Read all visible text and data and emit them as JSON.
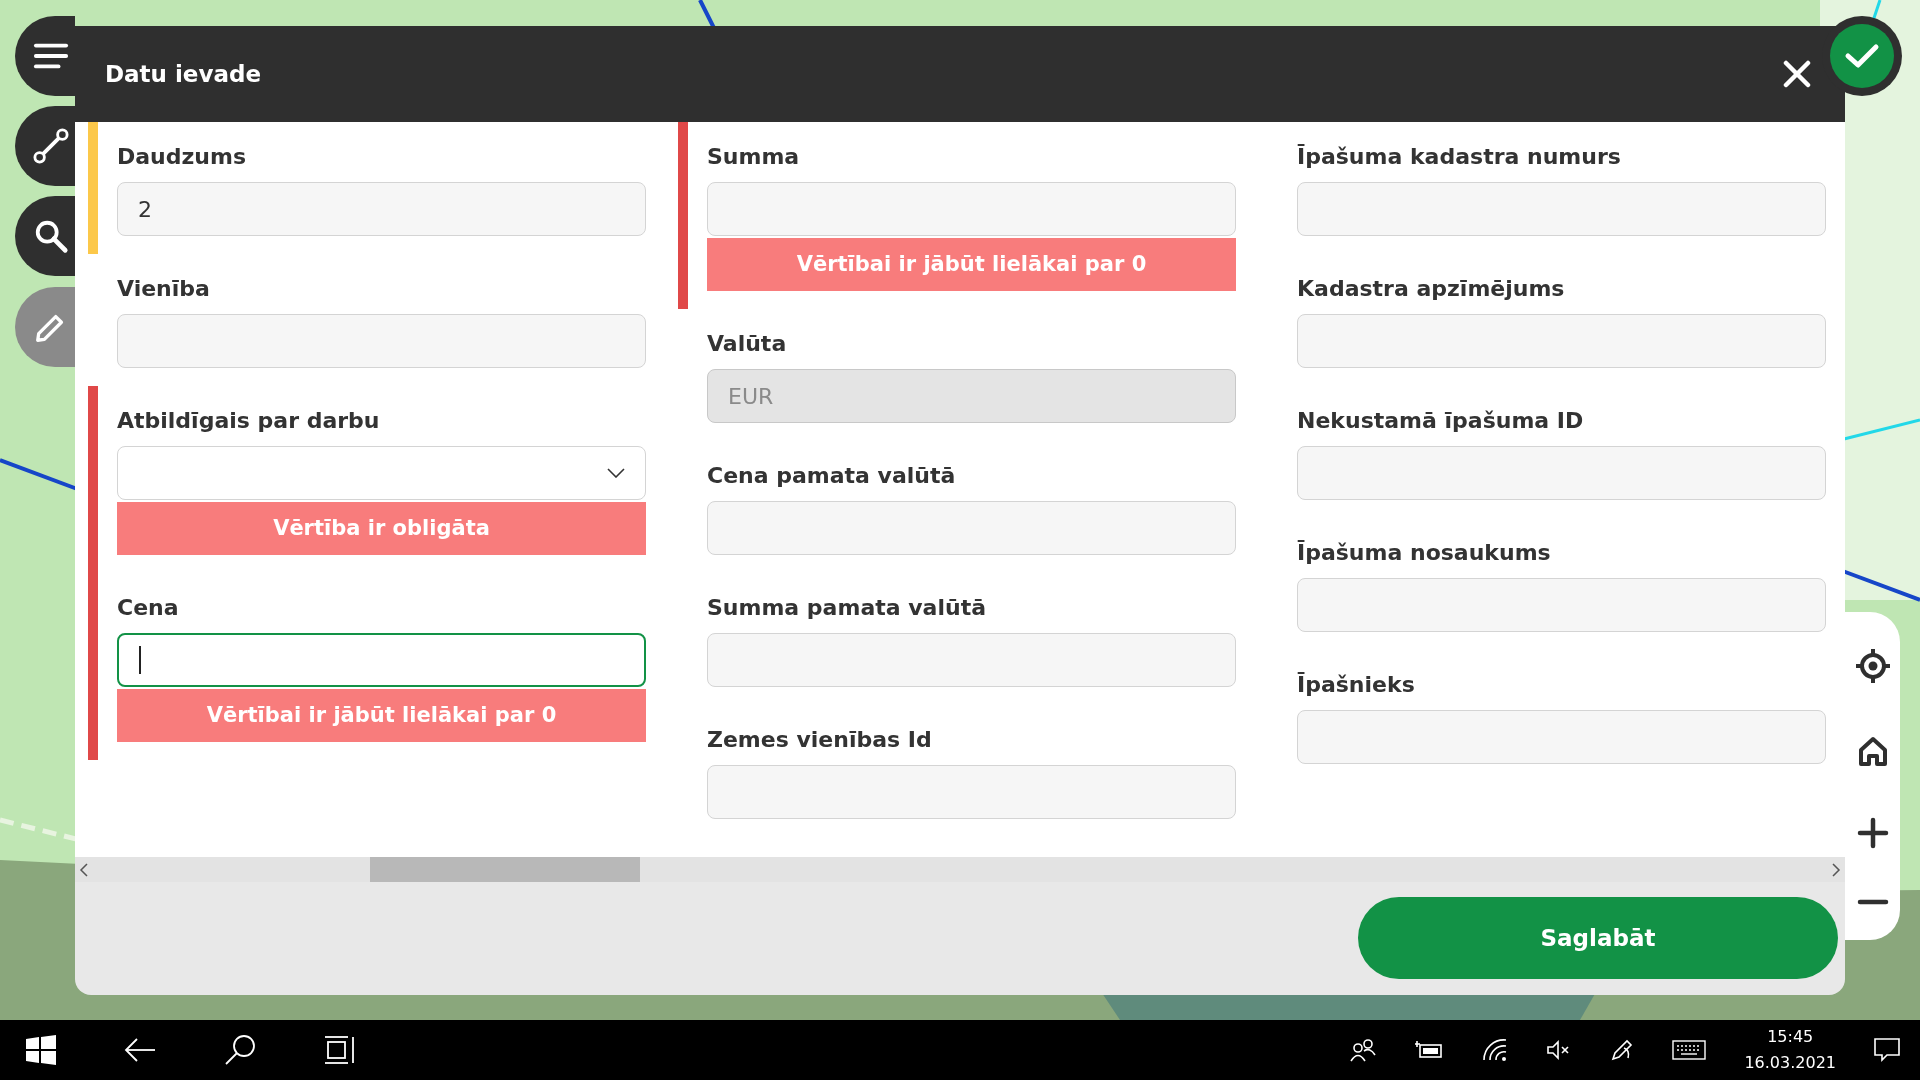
{
  "dialog": {
    "title": "Datu ievade",
    "save_button": "Saglabāt"
  },
  "columns": [
    [
      {
        "label": "Daudzums",
        "kind": "text",
        "value": "2",
        "color": "#fcc84a",
        "disabled": false,
        "focused": false
      },
      {
        "label": "Vienība",
        "kind": "text",
        "disabled": false,
        "focused": false
      },
      {
        "label": "Atbildīgais par darbu",
        "kind": "select",
        "color": "#e04848",
        "error": "Vērtība ir obligāta",
        "disabled": false,
        "focused": false
      },
      {
        "label": "Cena",
        "kind": "text",
        "color": "#e04848",
        "error": "Vērtībai ir jābūt lielākai par 0",
        "disabled": false,
        "focused": true
      }
    ],
    [
      {
        "label": "Summa",
        "kind": "text",
        "color": "#e04848",
        "error": "Vērtībai ir jābūt lielākai par 0",
        "disabled": false,
        "focused": false
      },
      {
        "label": "Valūta",
        "kind": "text",
        "value": "EUR",
        "disabled": true,
        "focused": false
      },
      {
        "label": "Cena pamata valūtā",
        "kind": "text",
        "disabled": false,
        "focused": false
      },
      {
        "label": "Summa pamata valūtā",
        "kind": "text",
        "disabled": false,
        "focused": false
      },
      {
        "label": "Zemes vienības Id",
        "kind": "text",
        "disabled": false,
        "focused": false
      }
    ],
    [
      {
        "label": "Īpašuma kadastra numurs",
        "kind": "text",
        "disabled": false,
        "focused": false
      },
      {
        "label": "Kadastra apzīmējums",
        "kind": "text",
        "disabled": false,
        "focused": false
      },
      {
        "label": "Nekustamā īpašuma ID",
        "kind": "text",
        "disabled": false,
        "focused": false
      },
      {
        "label": "Īpašuma nosaukums",
        "kind": "text",
        "disabled": false,
        "focused": false
      },
      {
        "label": "Īpašnieks",
        "kind": "text",
        "disabled": false,
        "focused": false
      }
    ]
  ],
  "taskbar": {
    "time": "15:45",
    "date": "16.03.2021"
  }
}
